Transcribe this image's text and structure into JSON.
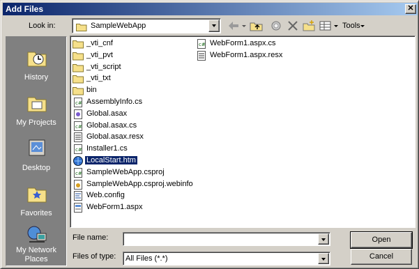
{
  "window": {
    "title": "Add Files",
    "close_glyph": "✕"
  },
  "lookin": {
    "label": "Look in:",
    "value": "SampleWebApp"
  },
  "toolbar": {
    "tools_label": "Tools"
  },
  "places": [
    {
      "label": "History",
      "icon": "history-icon"
    },
    {
      "label": "My Projects",
      "icon": "my-projects-icon"
    },
    {
      "label": "Desktop",
      "icon": "desktop-icon"
    },
    {
      "label": "Favorites",
      "icon": "favorites-icon"
    },
    {
      "label": "My Network Places",
      "icon": "network-places-icon"
    }
  ],
  "files": {
    "column1": [
      {
        "name": "_vti_cnf",
        "icon": "folder-icon"
      },
      {
        "name": "_vti_pvt",
        "icon": "folder-icon"
      },
      {
        "name": "_vti_script",
        "icon": "folder-icon"
      },
      {
        "name": "_vti_txt",
        "icon": "folder-icon"
      },
      {
        "name": "bin",
        "icon": "folder-icon"
      },
      {
        "name": "AssemblyInfo.cs",
        "icon": "csharp-file-icon"
      },
      {
        "name": "Global.asax",
        "icon": "asax-file-icon"
      },
      {
        "name": "Global.asax.cs",
        "icon": "csharp-file-icon"
      },
      {
        "name": "Global.asax.resx",
        "icon": "resx-file-icon"
      },
      {
        "name": "Installer1.cs",
        "icon": "csharp-file-icon"
      },
      {
        "name": "LocalStart.htm",
        "icon": "html-file-icon",
        "selected": true
      },
      {
        "name": "SampleWebApp.csproj",
        "icon": "csproj-file-icon"
      },
      {
        "name": "SampleWebApp.csproj.webinfo",
        "icon": "webinfo-file-icon"
      },
      {
        "name": "Web.config",
        "icon": "config-file-icon"
      },
      {
        "name": "WebForm1.aspx",
        "icon": "aspx-file-icon"
      }
    ],
    "column2": [
      {
        "name": "WebForm1.aspx.cs",
        "icon": "csharp-file-icon"
      },
      {
        "name": "WebForm1.aspx.resx",
        "icon": "resx-file-icon"
      }
    ]
  },
  "filename": {
    "label": "File name:",
    "value": ""
  },
  "filetype": {
    "label": "Files of type:",
    "value": "All Files (*.*)"
  },
  "buttons": {
    "open": "Open",
    "cancel": "Cancel"
  },
  "colors": {
    "title_start": "#0a246a",
    "title_end": "#a6caf0",
    "face": "#d4d0c8",
    "selection": "#0a246a"
  }
}
